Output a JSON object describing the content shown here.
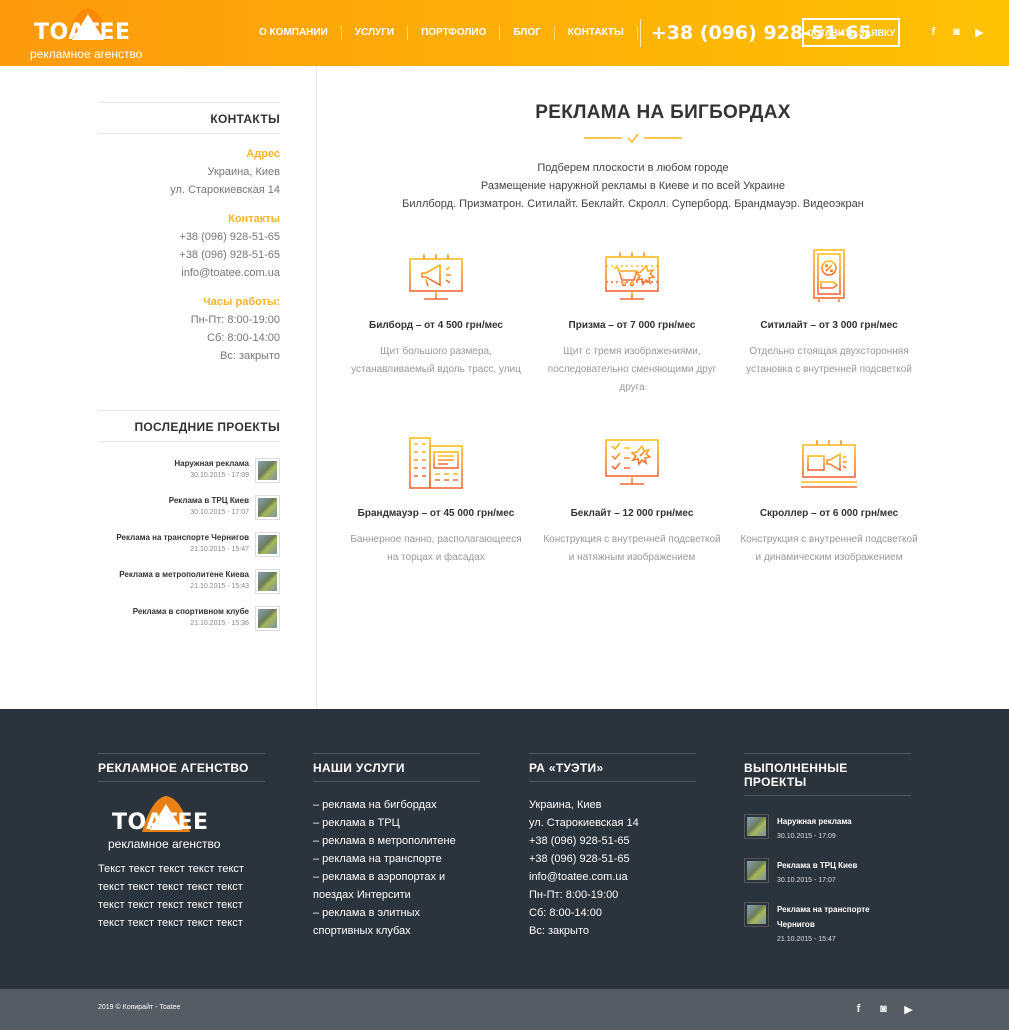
{
  "brand": {
    "name": "TOATEE",
    "tagline": "рекламное агенство"
  },
  "nav": {
    "items": [
      "О КОМПАНИИ",
      "УСЛУГИ",
      "ПОРТФОЛИО",
      "БЛОГ",
      "КОНТАКТЫ"
    ],
    "phone": "+38 (096) 928-51-65",
    "cta": "ОСТАВИТЬ ЗАЯВКУ"
  },
  "social": {
    "icons": [
      "facebook-icon",
      "instagram-icon",
      "youtube-icon"
    ],
    "glyphs": [
      "f",
      "◙",
      "▶"
    ]
  },
  "sidebar": {
    "contacts_title": "КОНТАКТЫ",
    "address_label": "Адрес",
    "address_lines": [
      "Украина, Киев",
      "ул. Старокиевская 14"
    ],
    "contacts_label": "Контакты",
    "contacts_lines": [
      "+38 (096) 928-51-65",
      "+38 (096) 928-51-65",
      "info@toatee.com.ua"
    ],
    "hours_label": "Часы работы:",
    "hours_lines": [
      "Пн-Пт: 8:00-19:00",
      "Сб: 8:00-14:00",
      "Вс: закрыто"
    ],
    "projects_title": "ПОСЛЕДНИЕ ПРОЕКТЫ",
    "projects": [
      {
        "name": "Наружная реклама",
        "date": "30.10.2015 - 17:09"
      },
      {
        "name": "Реклама в ТРЦ Киев",
        "date": "30.10.2015 - 17:07"
      },
      {
        "name": "Реклама на транспорте Чернигов",
        "date": "21.10.2015 - 15:47"
      },
      {
        "name": "Реклама в метрополитене Киева",
        "date": "21.10.2015 - 15:43"
      },
      {
        "name": "Реклама в спортивном клубе",
        "date": "21.10.2015 - 15:36"
      }
    ]
  },
  "main": {
    "title": "РЕКЛАМА НА БИГБОРДАХ",
    "intro": [
      "Подберем плоскости в любом городе",
      "Размещение наружной рекламы в Киеве и по всей Украине",
      "Биллборд. Призматрон. Ситилайт. Беклайт. Скролл. Суперборд. Брандмауэр. Видеоэкран"
    ],
    "services": [
      {
        "icon": "billboard-megaphone-icon",
        "title": "Билборд – от 4 500 грн/мес",
        "desc": "Щит большого размера, устанавливаемый вдоль трасс, улиц"
      },
      {
        "icon": "prism-cart-icon",
        "title": "Призма – от 7 000 грн/мес",
        "desc": "Щит с тремя изображениями, последовательно сменяющими друг друга"
      },
      {
        "icon": "citylight-percent-icon",
        "title": "Ситилайт – от 3 000 грн/мес",
        "desc": "Отдельно стоящая двухсторонняя установка с внутренней подсветкой"
      },
      {
        "icon": "building-icon",
        "title": "Брандмауэр – от 45 000 грн/мес",
        "desc": "Баннерное панно, располагающееся на торцах и фасадах"
      },
      {
        "icon": "backlight-screen-icon",
        "title": "Беклайт – 12 000 грн/мес",
        "desc": "Конструкция с внутренней подсветкой и натяжным изображением"
      },
      {
        "icon": "scroller-megaphone-icon",
        "title": "Скроллер – от 6 000 грн/мес",
        "desc": "Конструкция с внутренней подсветкой и динамическим изображением"
      }
    ]
  },
  "footer": {
    "col1_title": "РЕКЛАМНОЕ АГЕНСТВО",
    "col1_text": "Текст текст текст текст текст текст текст текст текст текст текст текст текст текст текст текст текст текст текст текст",
    "col2_title": "НАШИ УСЛУГИ",
    "services": [
      "– реклама на бигбордах",
      "– реклама в ТРЦ",
      "– реклама в метрополитене",
      "– реклама на транспорте",
      "– реклама в аэропортах и поездах Интерсити",
      "– реклама в элитных спортивных клубах"
    ],
    "col3_title": "РА «ТУЭТИ»",
    "contacts": [
      "Украина, Киев",
      "ул. Старокиевская 14",
      "+38 (096) 928-51-65",
      "+38 (096) 928-51-65",
      "info@toatee.com.ua",
      "Пн-Пт: 8:00-19:00",
      "Сб: 8:00-14:00",
      "Вс: закрыто"
    ],
    "col4_title": "ВЫПОЛНЕННЫЕ ПРОЕКТЫ",
    "projects": [
      {
        "name": "Наружная реклама",
        "date": "30.10.2015 - 17:09"
      },
      {
        "name": "Реклама в ТРЦ Киев",
        "date": "30.10.2015 - 17:07"
      },
      {
        "name": "Реклама на транспорте Чернигов",
        "date": "21.10.2015 - 15:47"
      }
    ],
    "copyright": "2019 © Копирайт - Toatee"
  },
  "colors": {
    "accent": "#f9b32a",
    "header_from": "#fd9a0c",
    "header_to": "#fec103",
    "footer_bg": "#2b333d",
    "bottom_bg": "#555c63",
    "icon_from": "#fdbd1f",
    "icon_to": "#f2683a"
  }
}
